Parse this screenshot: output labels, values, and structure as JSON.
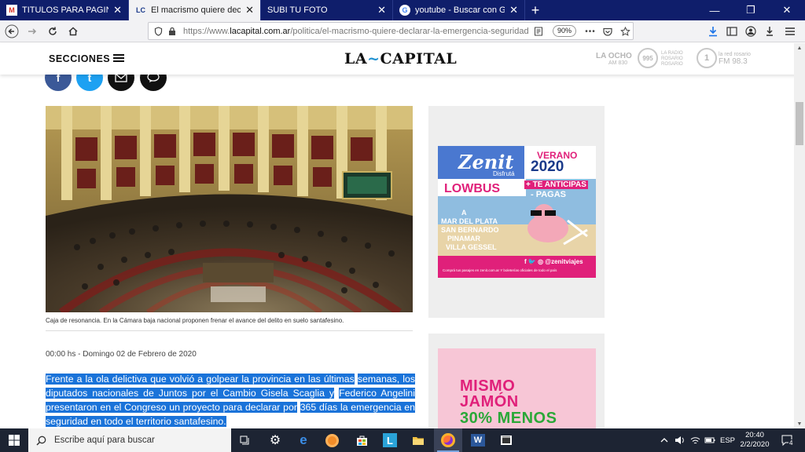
{
  "browser": {
    "tabs": [
      {
        "label": "TITULOS PARA PAGINA - agosto",
        "favicon": "M",
        "close": "✕"
      },
      {
        "label": "El macrismo quiere declarar la em",
        "favicon": "LC",
        "close": "✕"
      },
      {
        "label": "SUBI TU FOTO",
        "favicon": "",
        "close": "✕"
      },
      {
        "label": "youtube - Buscar con Google",
        "favicon": "G",
        "close": "✕"
      }
    ],
    "new_tab": "+",
    "window_controls": {
      "minimize": "—",
      "restore": "❐",
      "close": "✕"
    },
    "url_prefix": "https://www.",
    "url_domain": "lacapital.com.ar",
    "url_path": "/politica/el-macrismo-quiere-declarar-la-emergencia-seguridad",
    "zoom": "90%",
    "page_actions": "•••"
  },
  "site": {
    "secciones": "SECCIONES",
    "logo_left": "LA",
    "logo_right": "CAPITAL",
    "radios": [
      {
        "top": "LA OCHO",
        "bottom": "AM 830"
      },
      {
        "circle": "995",
        "top": "LA RADIO",
        "middle": "ROSARIO",
        "bottom": "ROSARIO"
      },
      {
        "circle": "1",
        "top": "la red rosario",
        "bottom": "FM 98.3"
      }
    ],
    "share": [
      {
        "label": "f",
        "color": "#3b5998"
      },
      {
        "label": "t",
        "color": "#1da1f2"
      },
      {
        "label": "✉",
        "color": "#111111"
      },
      {
        "label": "💬",
        "color": "#111111"
      }
    ]
  },
  "article": {
    "caption": "Caja de resonancia. En la Cámara baja nacional proponen frenar el avance del delito en suelo santafesino.",
    "dateline": "00:00 hs - Domingo 02 de Febrero de 2020",
    "lead": [
      "Frente a la ola delictiva que volvió a golpear la provincia en las últimas",
      "semanas, los diputados nacionales de Juntos por el Cambio Gisela Scaglia y",
      "Federico Angelini presentaron en el Congreso un proyecto para declarar por",
      "365 días la emergencia en seguridad en todo el territorio santafesino."
    ]
  },
  "ads": {
    "zenit": {
      "brand": "Zenit",
      "brand_sub": "Disfrutá",
      "verano": "VERANO",
      "year": "2020",
      "lowbus": "LOWBUS",
      "promo1": "+ TE ANTICIPAS",
      "promo2": "- PAGAS",
      "dest0": "A",
      "dest1": "MAR DEL PLATA",
      "dest2": "SAN BERNARDO",
      "dest3": "PINAMAR",
      "dest4": "VILLA GESSEL",
      "social": "f 🐦 ◎ @zenitviajes",
      "footer": "Comprá tus pasajes en zenit.com.ar Y boleterías oficiales de todo el país"
    },
    "mismo": {
      "line1": "MISMO",
      "line2": "JAMÓN",
      "line3": "30% MENOS"
    }
  },
  "taskbar": {
    "search_placeholder": "Escribe aquí para buscar",
    "language": "ESP",
    "time": "20:40",
    "date": "2/2/2020",
    "notifications": "4"
  }
}
